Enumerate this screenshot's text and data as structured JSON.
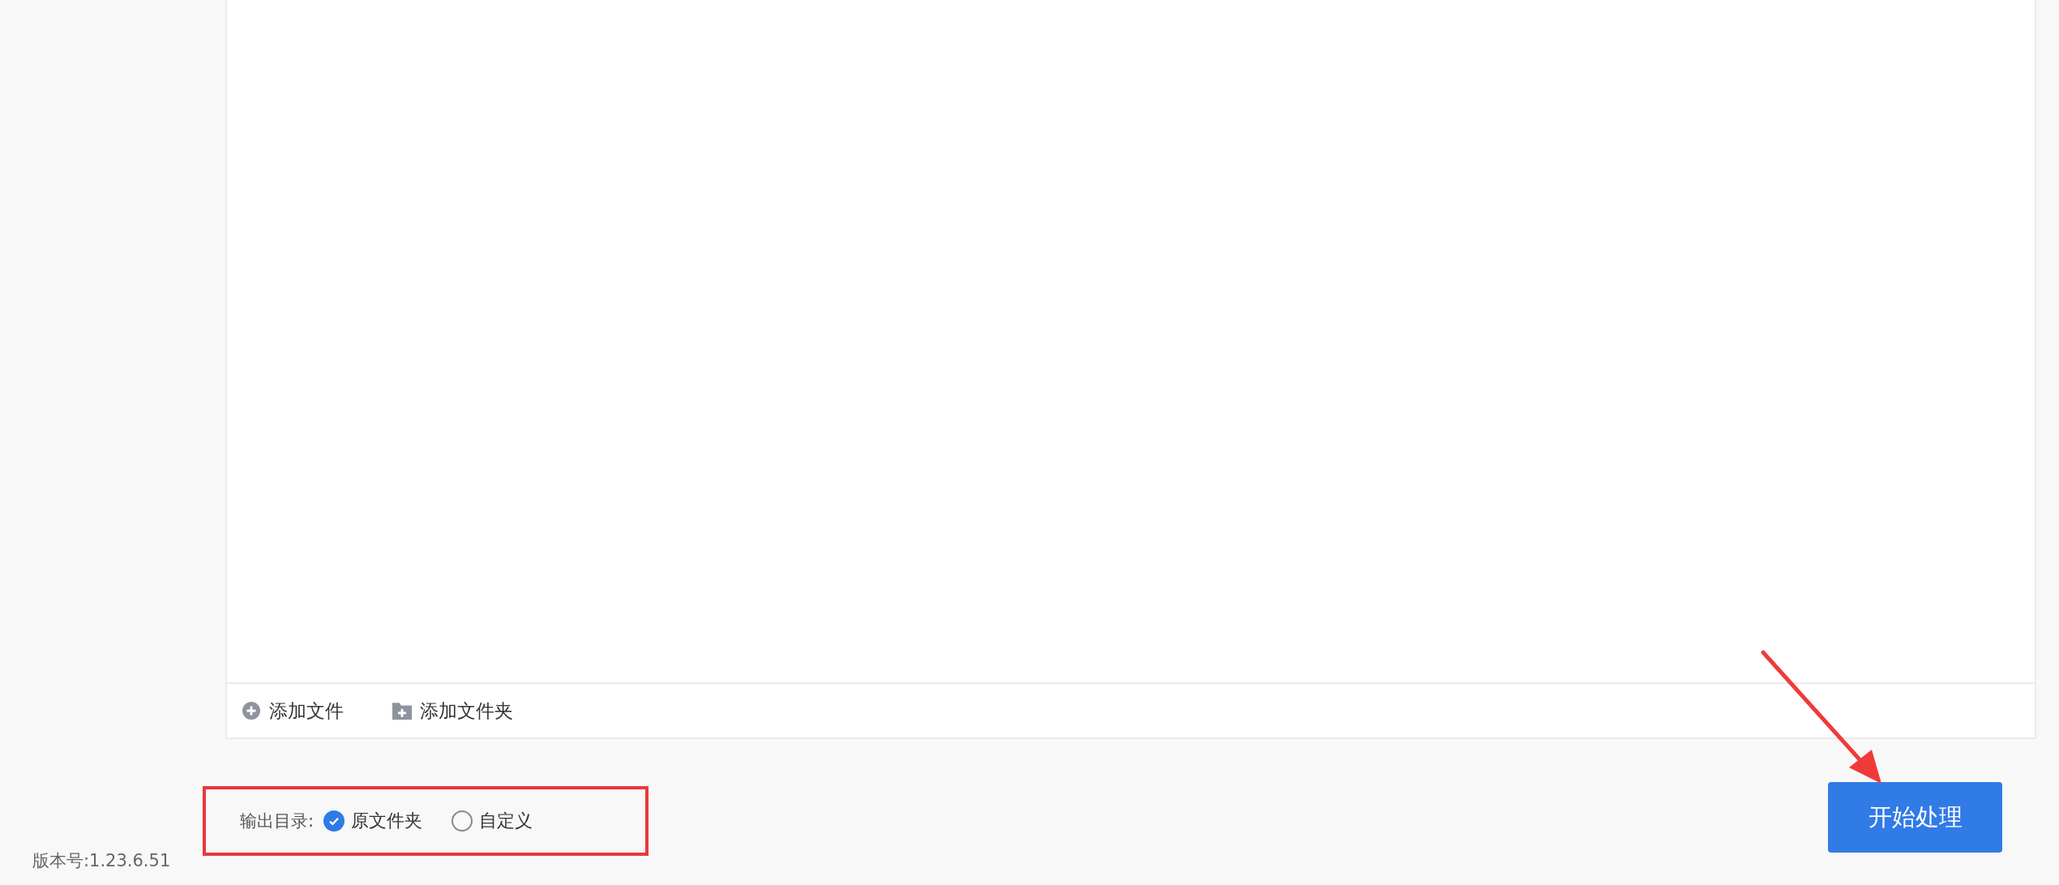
{
  "file_panel": {
    "actions": [
      {
        "kind": "file",
        "label": "添加文件"
      },
      {
        "kind": "folder",
        "label": "添加文件夹"
      }
    ]
  },
  "output_directory": {
    "label": "输出目录:",
    "options": [
      {
        "label": "原文件夹",
        "selected": true
      },
      {
        "label": "自定义",
        "selected": false
      }
    ]
  },
  "start_button": {
    "label": "开始处理"
  },
  "version": "版本号:1.23.6.51"
}
